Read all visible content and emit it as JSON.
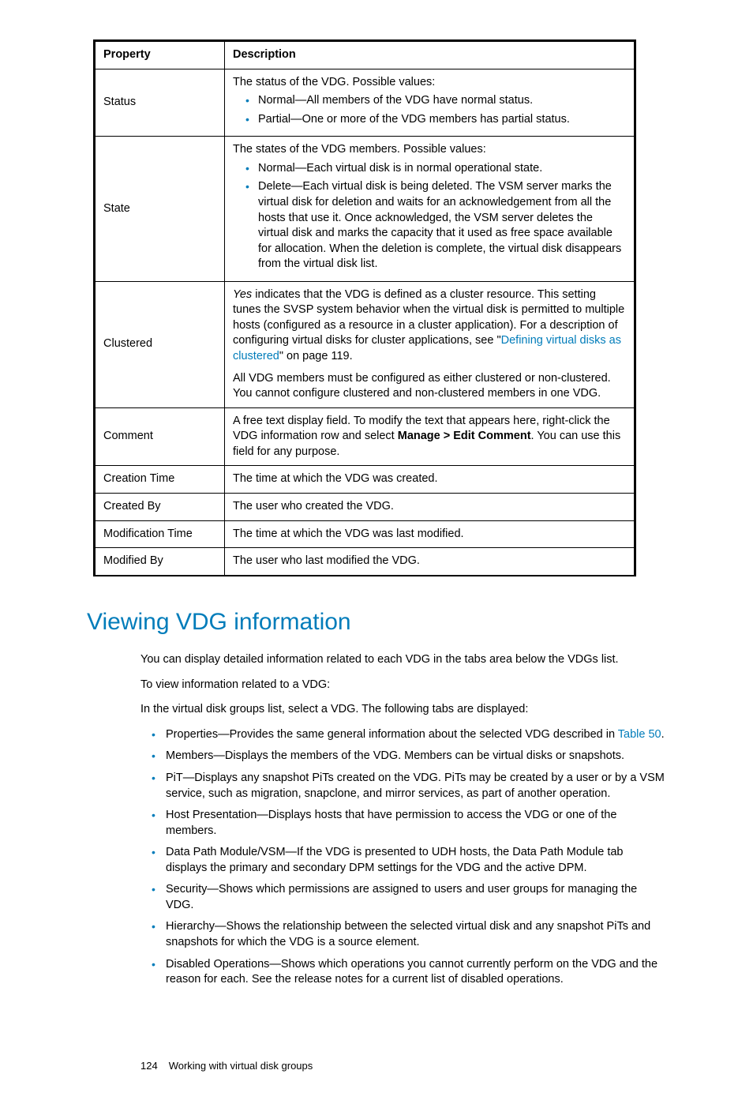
{
  "table": {
    "headers": [
      "Property",
      "Description"
    ],
    "rows": {
      "status": {
        "prop": "Status",
        "intro": "The status of the VDG. Possible values:",
        "bullets": [
          "Normal—All members of the VDG have normal status.",
          "Partial—One or more of the VDG members has partial status."
        ]
      },
      "state": {
        "prop": "State",
        "intro": "The states of the VDG members. Possible values:",
        "bullets": [
          "Normal—Each virtual disk is in normal operational state.",
          "Delete—Each virtual disk is being deleted. The VSM server marks the virtual disk for deletion and waits for an acknowledgement from all the hosts that use it. Once acknowledged, the VSM server deletes the virtual disk and marks the capacity that it used as free space available for allocation. When the deletion is complete, the virtual disk disappears from the virtual disk list."
        ]
      },
      "clustered": {
        "prop": "Clustered",
        "para1_pre_italic": "Yes",
        "para1_post": " indicates that the VDG is defined as a cluster resource. This setting tunes the SVSP system behavior when the virtual disk is permitted to multiple hosts (configured as a resource in a cluster application). For a description of configuring virtual disks for cluster applications, see \"",
        "para1_link": "Defining virtual disks as clustered",
        "para1_tail": "\" on page 119.",
        "para2": "All VDG members must be configured as either clustered or non-clustered. You cannot configure clustered and non-clustered members in one VDG."
      },
      "comment": {
        "prop": "Comment",
        "pre": "A free text display field. To modify the text that appears here, right-click the VDG information row and select ",
        "bold": "Manage > Edit Comment",
        "post": ". You can use this field for any purpose."
      },
      "creation_time": {
        "prop": "Creation Time",
        "desc": "The time at which the VDG was created."
      },
      "created_by": {
        "prop": "Created By",
        "desc": "The user who created the VDG."
      },
      "mod_time": {
        "prop": "Modification Time",
        "desc": "The time at which the VDG was last modified."
      },
      "mod_by": {
        "prop": "Modified By",
        "desc": "The user who last modified the VDG."
      }
    }
  },
  "section": {
    "heading": "Viewing VDG information",
    "p1": "You can display detailed information related to each VDG in the tabs area below the VDGs list.",
    "p2": "To view information related to a VDG:",
    "p3": "In the virtual disk groups list, select a VDG. The following tabs are displayed:",
    "bullets": {
      "b1_pre": "Properties—Provides the same general information about the selected VDG described in ",
      "b1_link": "Table 50",
      "b1_post": ".",
      "b2": "Members—Displays the members of the VDG. Members can be virtual disks or snapshots.",
      "b3": "PiT—Displays any snapshot PiTs created on the VDG. PiTs may be created by a user or by a VSM service, such as migration, snapclone, and mirror services, as part of another operation.",
      "b4": "Host Presentation—Displays hosts that have permission to access the VDG or one of the members.",
      "b5": "Data Path Module/VSM—If the VDG is presented to UDH hosts, the Data Path Module tab displays the primary and secondary DPM settings for the VDG and the active DPM.",
      "b6": "Security—Shows which permissions are assigned to users and user groups for managing the VDG.",
      "b7": "Hierarchy—Shows the relationship between the selected virtual disk and any snapshot PiTs and snapshots for which the VDG is a source element.",
      "b8": "Disabled Operations—Shows which operations you cannot currently perform on the VDG and the reason for each. See the release notes for a current list of disabled operations."
    }
  },
  "footer": {
    "page": "124",
    "title": "Working with virtual disk groups"
  }
}
